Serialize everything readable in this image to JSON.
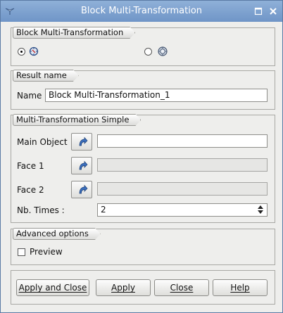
{
  "window": {
    "title": "Block Multi-Transformation"
  },
  "icons": {
    "app": "app-icon",
    "minimize": "minimize-icon",
    "close": "close-icon",
    "select": "select-arrow-icon"
  },
  "method_group": {
    "legend": "Block Multi-Transformation",
    "options": [
      {
        "icon": "simple-transformation-icon",
        "selected": true
      },
      {
        "icon": "double-transformation-icon",
        "selected": false
      }
    ]
  },
  "result_group": {
    "legend": "Result name",
    "name_label": "Name",
    "name_value": "Block Multi-Transformation_1"
  },
  "transform_group": {
    "legend": "Multi-Transformation Simple",
    "main_object_label": "Main Object",
    "main_object_value": "",
    "face1_label": "Face 1",
    "face1_value": "",
    "face2_label": "Face 2",
    "face2_value": "",
    "nb_times_label": "Nb. Times :",
    "nb_times_value": "2"
  },
  "advanced_group": {
    "legend": "Advanced options",
    "preview_label": "Preview",
    "preview_checked": false
  },
  "buttons": {
    "apply_close": "Apply and Close",
    "apply": "Apply",
    "close": "Close",
    "help": "Help"
  }
}
